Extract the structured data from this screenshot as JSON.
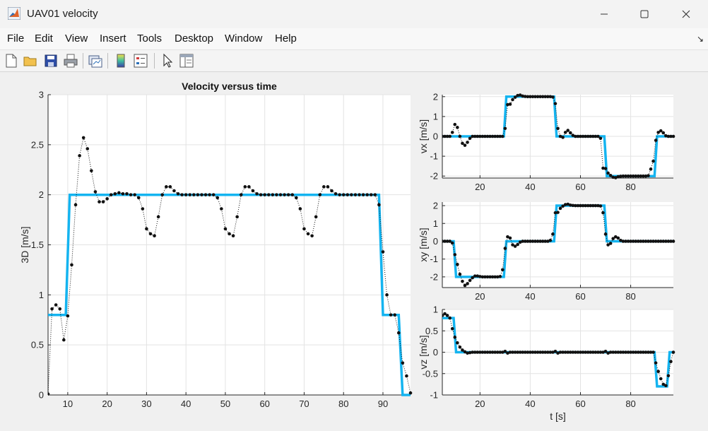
{
  "window": {
    "title": "UAV01 velocity",
    "minimize_icon": "minimize-icon",
    "maximize_icon": "maximize-icon",
    "close_icon": "close-icon"
  },
  "menu": {
    "items": [
      "File",
      "Edit",
      "View",
      "Insert",
      "Tools",
      "Desktop",
      "Window",
      "Help"
    ]
  },
  "toolbar": {
    "icons": [
      "new-figure-icon",
      "open-icon",
      "save-icon",
      "print-icon",
      "link-plot-icon",
      "colorbar-icon",
      "legend-icon",
      "pointer-icon",
      "property-inspector-icon"
    ]
  },
  "colors": {
    "reference": "#14b4f0",
    "measured": "#111111"
  },
  "chart_data": [
    {
      "type": "line",
      "title": "Velocity versus time",
      "xlabel": "",
      "ylabel": "3D [m/s]",
      "xlim": [
        5,
        97
      ],
      "ylim": [
        0,
        3
      ],
      "xticks": [
        10,
        20,
        30,
        40,
        50,
        60,
        70,
        80,
        90
      ],
      "yticks": [
        0,
        0.5,
        1,
        1.5,
        2,
        2.5,
        3
      ],
      "yticklabels": [
        "0",
        "0.5",
        "1",
        "1.5",
        "2",
        "2.5",
        "3"
      ],
      "grid": true,
      "series": [
        {
          "style": "reference-solid",
          "x": [
            5,
            9.5,
            10.5,
            89,
            90,
            94,
            95,
            97
          ],
          "y": [
            0.8,
            0.8,
            2.0,
            2.0,
            0.8,
            0.8,
            0,
            0
          ]
        },
        {
          "style": "measured-dotted",
          "x": [
            5,
            6,
            7,
            8,
            9,
            10,
            11,
            12,
            13,
            14,
            15,
            16,
            17,
            18,
            19,
            20,
            21,
            22,
            23,
            24,
            25,
            26,
            27,
            28,
            29,
            30,
            31,
            32,
            33,
            34,
            35,
            36,
            37,
            38,
            39,
            40,
            41,
            42,
            43,
            44,
            45,
            46,
            47,
            48,
            49,
            50,
            51,
            52,
            53,
            54,
            55,
            56,
            57,
            58,
            59,
            60,
            61,
            62,
            63,
            64,
            65,
            66,
            67,
            68,
            69,
            70,
            71,
            72,
            73,
            74,
            75,
            76,
            77,
            78,
            79,
            80,
            81,
            82,
            83,
            84,
            85,
            86,
            87,
            88,
            89,
            90,
            91,
            92,
            93,
            94,
            95,
            96,
            97
          ],
          "y": [
            0.01,
            0.86,
            0.9,
            0.86,
            0.55,
            0.79,
            1.3,
            1.9,
            2.39,
            2.57,
            2.46,
            2.24,
            2.03,
            1.93,
            1.93,
            1.96,
            2.0,
            2.01,
            2.02,
            2.01,
            2.01,
            2.0,
            2.0,
            1.97,
            1.86,
            1.66,
            1.61,
            1.59,
            1.78,
            2.0,
            2.08,
            2.08,
            2.04,
            2.01,
            2.0,
            2.0,
            2.0,
            2.0,
            2.0,
            2.0,
            2.0,
            2.0,
            2.0,
            1.97,
            1.86,
            1.66,
            1.61,
            1.59,
            1.78,
            2.0,
            2.08,
            2.08,
            2.04,
            2.01,
            2.0,
            2.0,
            2.0,
            2.0,
            2.0,
            2.0,
            2.0,
            2.0,
            2.0,
            1.97,
            1.86,
            1.66,
            1.61,
            1.59,
            1.78,
            2.0,
            2.08,
            2.08,
            2.04,
            2.01,
            2.0,
            2.0,
            2.0,
            2.0,
            2.0,
            2.0,
            2.0,
            2.0,
            2.0,
            2.0,
            1.9,
            1.43,
            1.0,
            0.8,
            0.8,
            0.62,
            0.32,
            0.19,
            0.02
          ]
        }
      ]
    },
    {
      "type": "line",
      "xlabel": "",
      "ylabel": "vx [m/s]",
      "xlim": [
        5,
        97
      ],
      "ylim": [
        -2.1,
        2.1
      ],
      "xticks": [
        20,
        40,
        60,
        80
      ],
      "yticks": [
        -2,
        -1,
        0,
        1,
        2
      ],
      "yticklabels": [
        "-2",
        "-1",
        "0",
        "1",
        "2"
      ],
      "grid": true,
      "series": [
        {
          "style": "reference-solid",
          "x": [
            5,
            29.5,
            30.5,
            49.5,
            50.5,
            69.5,
            70.5,
            89.5,
            90.5,
            97
          ],
          "y": [
            0,
            0,
            2,
            2,
            0,
            0,
            -2,
            -2,
            0,
            0
          ]
        },
        {
          "style": "measured-dotted",
          "x": [
            5,
            6,
            7,
            8,
            9,
            10,
            11,
            12,
            13,
            14,
            15,
            16,
            17,
            18,
            19,
            20,
            21,
            22,
            23,
            24,
            25,
            26,
            27,
            28,
            29,
            30,
            31,
            32,
            33,
            34,
            35,
            36,
            37,
            38,
            39,
            40,
            41,
            42,
            43,
            44,
            45,
            46,
            47,
            48,
            49,
            50,
            51,
            52,
            53,
            54,
            55,
            56,
            57,
            58,
            59,
            60,
            61,
            62,
            63,
            64,
            65,
            66,
            67,
            68,
            69,
            70,
            71,
            72,
            73,
            74,
            75,
            76,
            77,
            78,
            79,
            80,
            81,
            82,
            83,
            84,
            85,
            86,
            87,
            88,
            89,
            90,
            91,
            92,
            93,
            94,
            95,
            96,
            97
          ],
          "y": [
            0,
            0,
            0,
            0,
            0.2,
            0.6,
            0.45,
            0.0,
            -0.35,
            -0.45,
            -0.3,
            -0.1,
            0,
            0,
            0,
            0,
            0,
            0,
            0,
            0,
            0,
            0,
            0,
            0,
            0,
            0.4,
            1.6,
            1.62,
            1.85,
            1.97,
            2.06,
            2.08,
            2.03,
            2.01,
            2.0,
            2.0,
            2.0,
            2.0,
            2.0,
            2.0,
            2.0,
            2.0,
            2.0,
            2.0,
            1.98,
            1.65,
            0.4,
            0.0,
            -0.05,
            0.2,
            0.3,
            0.18,
            0.05,
            0,
            0,
            0,
            0,
            0,
            0,
            0,
            0,
            0,
            0,
            -0.1,
            -1.6,
            -1.62,
            -1.85,
            -1.97,
            -2.06,
            -2.08,
            -2.03,
            -2.01,
            -2.0,
            -2.0,
            -2.0,
            -2.0,
            -2.0,
            -2.0,
            -2.0,
            -2.0,
            -2.0,
            -2.0,
            -1.98,
            -1.65,
            -1.25,
            -0.2,
            0.2,
            0.28,
            0.18,
            0.03,
            0.0,
            0.0,
            0.0
          ]
        }
      ]
    },
    {
      "type": "line",
      "xlabel": "",
      "ylabel": "xy [m/s]",
      "xlim": [
        5,
        97
      ],
      "ylim": [
        -2.6,
        2.2
      ],
      "xticks": [
        20,
        40,
        60,
        80
      ],
      "yticks": [
        -2,
        -1,
        0,
        1,
        2
      ],
      "yticklabels": [
        "-2",
        "-1",
        "0",
        "1",
        "2"
      ],
      "grid": true,
      "series": [
        {
          "style": "reference-solid",
          "x": [
            5,
            9.5,
            10.5,
            29.5,
            30.5,
            49.5,
            50.5,
            69.5,
            70.5,
            97
          ],
          "y": [
            0,
            0,
            -2,
            -2,
            0,
            0,
            2,
            2,
            0,
            0
          ]
        },
        {
          "style": "measured-dotted",
          "x": [
            5,
            6,
            7,
            8,
            9,
            10,
            11,
            12,
            13,
            14,
            15,
            16,
            17,
            18,
            19,
            20,
            21,
            22,
            23,
            24,
            25,
            26,
            27,
            28,
            29,
            30,
            31,
            32,
            33,
            34,
            35,
            36,
            37,
            38,
            39,
            40,
            41,
            42,
            43,
            44,
            45,
            46,
            47,
            48,
            49,
            50,
            51,
            52,
            53,
            54,
            55,
            56,
            57,
            58,
            59,
            60,
            61,
            62,
            63,
            64,
            65,
            66,
            67,
            68,
            69,
            70,
            71,
            72,
            73,
            74,
            75,
            76,
            77,
            78,
            79,
            80,
            81,
            82,
            83,
            84,
            85,
            86,
            87,
            88,
            89,
            90,
            91,
            92,
            93,
            94,
            95,
            96,
            97
          ],
          "y": [
            0,
            0,
            0,
            0,
            -0.1,
            -0.75,
            -1.3,
            -1.85,
            -2.25,
            -2.48,
            -2.38,
            -2.2,
            -2.05,
            -1.95,
            -1.95,
            -1.98,
            -2.0,
            -2.0,
            -2.0,
            -2.0,
            -2.0,
            -2.0,
            -2.0,
            -1.98,
            -1.6,
            -0.4,
            0.25,
            0.18,
            -0.2,
            -0.28,
            -0.18,
            -0.05,
            0,
            0,
            0,
            0,
            0,
            0,
            0,
            0,
            0,
            0,
            0,
            0.05,
            0.4,
            1.6,
            1.62,
            1.85,
            1.97,
            2.06,
            2.08,
            2.03,
            2.01,
            2.0,
            2.0,
            2.0,
            2.0,
            2.0,
            2.0,
            2.0,
            2.0,
            2.0,
            2.0,
            1.98,
            1.6,
            0.4,
            -0.2,
            -0.12,
            0.15,
            0.25,
            0.18,
            0.05,
            0,
            0,
            0,
            0,
            0,
            0,
            0,
            0,
            0,
            0,
            0,
            0,
            0,
            0,
            0,
            0,
            0,
            0,
            0,
            0,
            0
          ]
        }
      ]
    },
    {
      "type": "line",
      "xlabel": "t [s]",
      "ylabel": "vz [m/s]",
      "xlim": [
        5,
        97
      ],
      "ylim": [
        -1,
        1
      ],
      "xticks": [
        20,
        40,
        60,
        80
      ],
      "yticks": [
        -1,
        -0.5,
        0,
        0.5,
        1
      ],
      "yticklabels": [
        "-1",
        "-0.5",
        "0",
        "0.5",
        "1"
      ],
      "grid": true,
      "series": [
        {
          "style": "reference-solid",
          "x": [
            5,
            9.5,
            10.5,
            89.5,
            90.5,
            94.5,
            95.5,
            97
          ],
          "y": [
            0.8,
            0.8,
            0,
            0,
            -0.8,
            -0.8,
            0,
            0
          ]
        },
        {
          "style": "measured-dotted",
          "x": [
            5,
            6,
            7,
            8,
            9,
            10,
            11,
            12,
            13,
            14,
            15,
            16,
            17,
            18,
            19,
            20,
            21,
            22,
            23,
            24,
            25,
            26,
            27,
            28,
            29,
            30,
            31,
            32,
            33,
            34,
            35,
            36,
            37,
            38,
            39,
            40,
            41,
            42,
            43,
            44,
            45,
            46,
            47,
            48,
            49,
            50,
            51,
            52,
            53,
            54,
            55,
            56,
            57,
            58,
            59,
            60,
            61,
            62,
            63,
            64,
            65,
            66,
            67,
            68,
            69,
            70,
            71,
            72,
            73,
            74,
            75,
            76,
            77,
            78,
            79,
            80,
            81,
            82,
            83,
            84,
            85,
            86,
            87,
            88,
            89,
            90,
            91,
            92,
            93,
            94,
            95,
            96,
            97
          ],
          "y": [
            0.86,
            0.9,
            0.86,
            0.8,
            0.55,
            0.35,
            0.22,
            0.12,
            0.05,
            0.01,
            -0.02,
            -0.01,
            0,
            0,
            0,
            0,
            0,
            0,
            0,
            0,
            0,
            0,
            0,
            0,
            0,
            0.02,
            -0.02,
            0,
            0,
            0,
            0,
            0,
            0,
            0,
            0,
            0,
            0,
            0,
            0,
            0,
            0,
            0,
            0,
            0,
            0,
            0.02,
            -0.02,
            0,
            0,
            0,
            0,
            0,
            0,
            0,
            0,
            0,
            0,
            0,
            0,
            0,
            0,
            0,
            0,
            0,
            0,
            0.02,
            -0.02,
            0,
            0,
            0,
            0,
            0,
            0,
            0,
            0,
            0,
            0,
            0,
            0,
            0,
            0,
            0,
            0,
            0,
            0,
            -0.25,
            -0.45,
            -0.62,
            -0.75,
            -0.78,
            -0.55,
            -0.22,
            0.0
          ]
        }
      ]
    }
  ]
}
